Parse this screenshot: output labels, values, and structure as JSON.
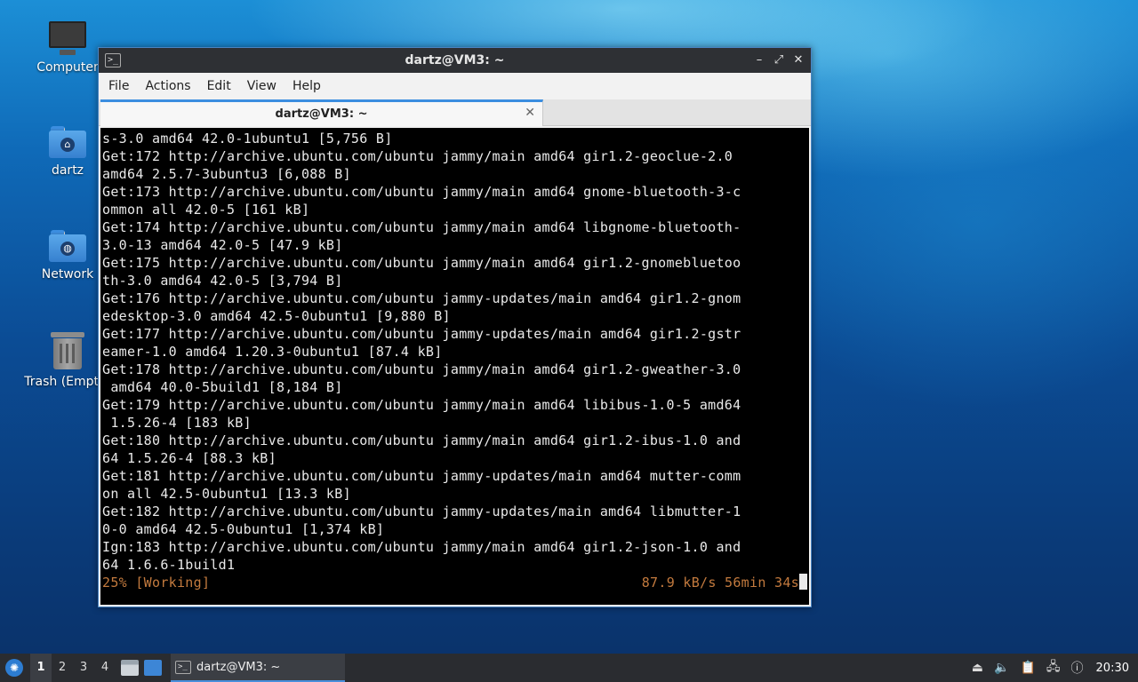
{
  "desktop": {
    "icons": [
      {
        "label": "Computer"
      },
      {
        "label": "dartz"
      },
      {
        "label": "Network"
      },
      {
        "label": "Trash (Empty)"
      }
    ]
  },
  "window": {
    "title": "dartz@VM3: ~",
    "menu": [
      "File",
      "Actions",
      "Edit",
      "View",
      "Help"
    ],
    "tab_title": "dartz@VM3: ~",
    "controls": {
      "minimize": "–",
      "maximize": "⤢",
      "close": "✕"
    }
  },
  "terminal": {
    "lines": [
      "s-3.0 amd64 42.0-1ubuntu1 [5,756 B]",
      "Get:172 http://archive.ubuntu.com/ubuntu jammy/main amd64 gir1.2-geoclue-2.0",
      "amd64 2.5.7-3ubuntu3 [6,088 B]",
      "Get:173 http://archive.ubuntu.com/ubuntu jammy/main amd64 gnome-bluetooth-3-c",
      "ommon all 42.0-5 [161 kB]",
      "Get:174 http://archive.ubuntu.com/ubuntu jammy/main amd64 libgnome-bluetooth-",
      "3.0-13 amd64 42.0-5 [47.9 kB]",
      "Get:175 http://archive.ubuntu.com/ubuntu jammy/main amd64 gir1.2-gnomebluetoo",
      "th-3.0 amd64 42.0-5 [3,794 B]",
      "Get:176 http://archive.ubuntu.com/ubuntu jammy-updates/main amd64 gir1.2-gnom",
      "edesktop-3.0 amd64 42.5-0ubuntu1 [9,880 B]",
      "Get:177 http://archive.ubuntu.com/ubuntu jammy-updates/main amd64 gir1.2-gstr",
      "eamer-1.0 amd64 1.20.3-0ubuntu1 [87.4 kB]",
      "Get:178 http://archive.ubuntu.com/ubuntu jammy/main amd64 gir1.2-gweather-3.0",
      " amd64 40.0-5build1 [8,184 B]",
      "Get:179 http://archive.ubuntu.com/ubuntu jammy/main amd64 libibus-1.0-5 amd64",
      " 1.5.26-4 [183 kB]",
      "Get:180 http://archive.ubuntu.com/ubuntu jammy/main amd64 gir1.2-ibus-1.0 and",
      "64 1.5.26-4 [88.3 kB]",
      "Get:181 http://archive.ubuntu.com/ubuntu jammy-updates/main amd64 mutter-comm",
      "on all 42.5-0ubuntu1 [13.3 kB]",
      "Get:182 http://archive.ubuntu.com/ubuntu jammy-updates/main amd64 libmutter-1",
      "0-0 amd64 42.5-0ubuntu1 [1,374 kB]",
      "Ign:183 http://archive.ubuntu.com/ubuntu jammy/main amd64 gir1.2-json-1.0 and",
      "64 1.6.6-1build1"
    ],
    "status_left": "25% [Working]",
    "status_right": "87.9 kB/s 56min 34s"
  },
  "taskbar": {
    "workspaces": [
      "1",
      "2",
      "3",
      "4"
    ],
    "active_workspace": "1",
    "task_label": "dartz@VM3: ~",
    "clock": "20:30"
  },
  "icons": {
    "start": "lubuntu-logo-icon",
    "files": "file-manager-icon",
    "desktop": "show-desktop-icon",
    "tray": [
      "eject-icon",
      "volume-icon",
      "clipboard-icon",
      "network-icon",
      "update-notifier-icon"
    ]
  }
}
